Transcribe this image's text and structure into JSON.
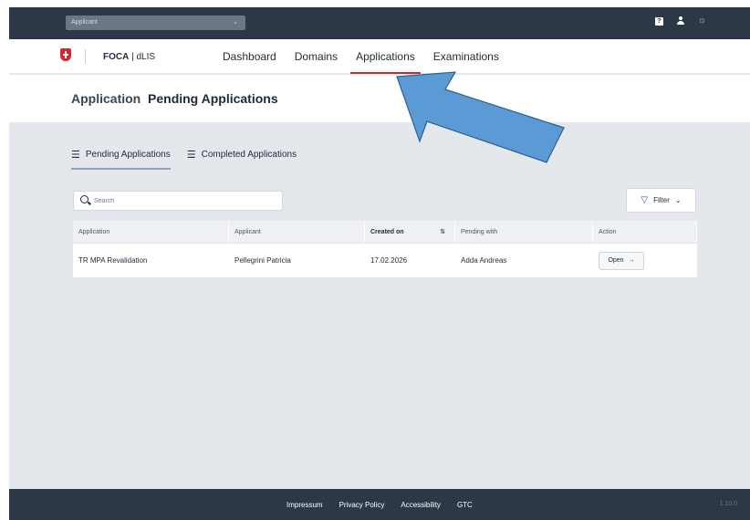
{
  "topbar": {
    "role_select_value": "Applicant",
    "help_icon_label": "?"
  },
  "navbar": {
    "brand_bold": "FOCA",
    "brand_sep": " | ",
    "brand_rest": "dLIS",
    "items": [
      {
        "label": "Dashboard",
        "active": false
      },
      {
        "label": "Domains",
        "active": false
      },
      {
        "label": "Applications",
        "active": true
      },
      {
        "label": "Examinations",
        "active": false
      }
    ]
  },
  "header": {
    "section": "Application",
    "title": "Pending Applications"
  },
  "tabs": [
    {
      "label": "Pending Applications",
      "icon": "list-icon",
      "active": true
    },
    {
      "label": "Completed Applications",
      "icon": "checklist-icon",
      "active": false
    }
  ],
  "search": {
    "placeholder": "Search",
    "value": ""
  },
  "filter": {
    "label": "Filter"
  },
  "table": {
    "columns": [
      "Application",
      "Applicant",
      "Created on",
      "Pending with",
      "Action"
    ],
    "rows": [
      {
        "application": "TR MPA Revalidation",
        "applicant": "Pellegrini Patricia",
        "created_on": "17.02.2026",
        "pending_with": "Adda Andreas",
        "action": "Open"
      }
    ]
  },
  "footer": {
    "links": [
      "Impressum",
      "Privacy Policy",
      "Accessibility",
      "GTC"
    ],
    "version": "1.10.0"
  },
  "colors": {
    "dark_bar": "#2c3845",
    "accent_red": "#d8232a",
    "content_bg": "#e4e7eb",
    "arrow_fill": "#5b9bd5"
  }
}
